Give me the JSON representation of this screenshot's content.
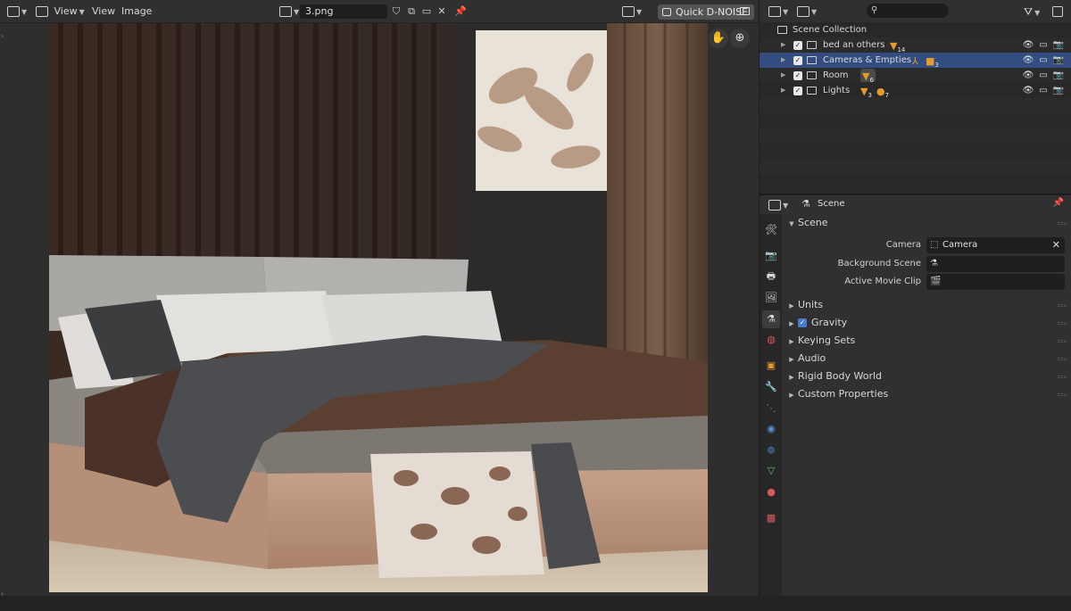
{
  "image_editor": {
    "header": {
      "view_menu_1": "View",
      "view_menu_2": "View",
      "image_menu": "Image",
      "image_name": "3.png",
      "quick_denoise": "Quick D-NOISE"
    }
  },
  "outliner": {
    "root": "Scene Collection",
    "items": [
      {
        "label": "bed an others",
        "count": "14"
      },
      {
        "label": "Cameras & Empties",
        "count": "3"
      },
      {
        "label": "Room",
        "count": "6"
      },
      {
        "label": "Lights",
        "count_mesh": "3",
        "count_light": "7"
      }
    ]
  },
  "properties": {
    "context": "Scene",
    "panel_scene": "Scene",
    "camera_label": "Camera",
    "camera_value": "Camera",
    "background_scene_label": "Background Scene",
    "active_movie_clip_label": "Active Movie Clip",
    "panels": [
      "Units",
      "Gravity",
      "Keying Sets",
      "Audio",
      "Rigid Body World",
      "Custom Properties"
    ]
  },
  "colors": {
    "selected_row": "#334d80",
    "object_accent": "#e69a2e",
    "gravity_check": "#4b7bd1"
  }
}
